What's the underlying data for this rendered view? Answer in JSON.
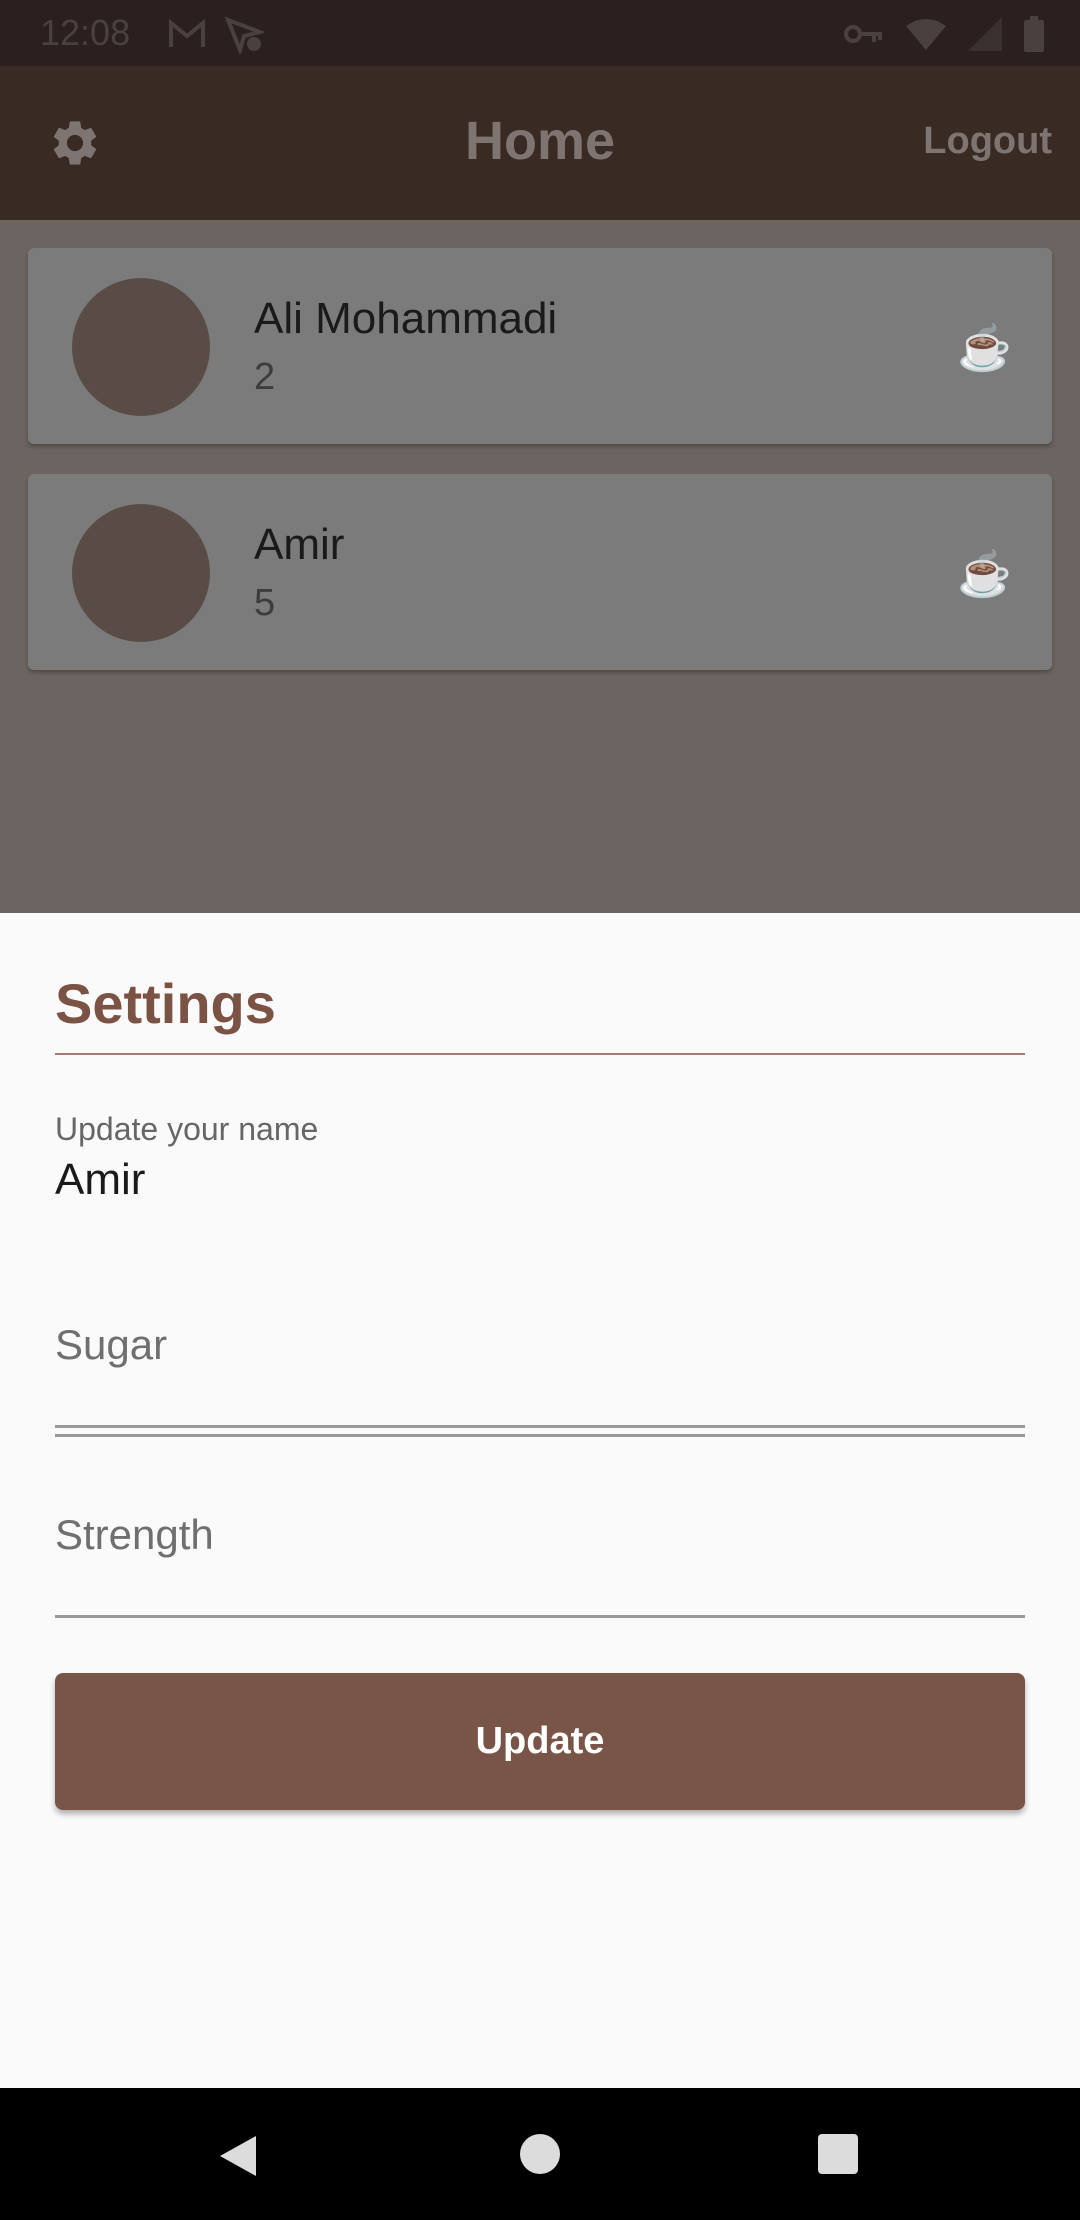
{
  "status_bar": {
    "time": "12:08",
    "left_icons": [
      "gmail-icon",
      "location-off-icon"
    ],
    "right_icons": [
      "vpn-key-icon",
      "wifi-icon",
      "signal-icon",
      "battery-icon"
    ]
  },
  "app_bar": {
    "title": "Home",
    "settings_icon": "gear-icon",
    "logout_label": "Logout"
  },
  "list": {
    "items": [
      {
        "name": "Ali Mohammadi",
        "value": "2",
        "icon": "coffee-cup-icon"
      },
      {
        "name": "Amir",
        "value": "5",
        "icon": "coffee-cup-icon"
      }
    ]
  },
  "settings_sheet": {
    "title": "Settings",
    "name_field": {
      "label": "Update your name",
      "value": "Amir"
    },
    "sugar_field": {
      "placeholder": "Sugar"
    },
    "strength_field": {
      "placeholder": "Strength"
    },
    "update_label": "Update"
  },
  "nav_bar": {
    "buttons": [
      "back-icon",
      "home-icon",
      "recents-icon"
    ]
  },
  "colors": {
    "primary": "#795548",
    "app_bar": "#3a2a24",
    "sheet_background": "#fafafa"
  }
}
